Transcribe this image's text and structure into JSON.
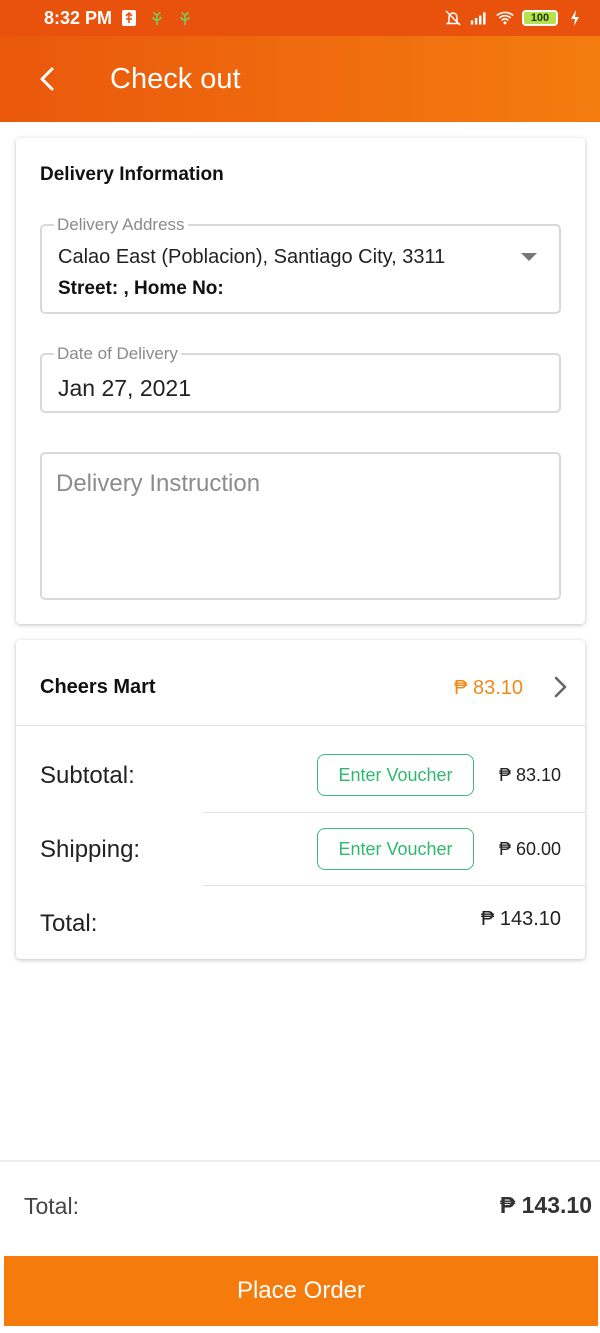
{
  "status_bar": {
    "time": "8:32 PM",
    "battery": "100",
    "left_icons": [
      "usb-icon",
      "plant-icon",
      "plant-icon"
    ],
    "right_icons": [
      "alarm-off-icon",
      "signal-icon",
      "wifi-icon",
      "battery-icon",
      "charging-icon"
    ]
  },
  "app_bar": {
    "title": "Check out",
    "back_icon": "arrow-back-icon",
    "background_color": "#ea580c"
  },
  "delivery": {
    "section_title": "Delivery Information",
    "address_label": "Delivery Address",
    "address_line1": "Calao East (Poblacion), Santiago City, 3311",
    "address_line2": "Street: , Home No:",
    "date_label": "Date of Delivery",
    "date_value": "Jan 27, 2021",
    "instruction_placeholder": "Delivery Instruction"
  },
  "store": {
    "name": "Cheers Mart",
    "total": "₱ 83.10",
    "accent_color": "#ef8a1a",
    "rows": {
      "subtotal_label": "Subtotal:",
      "subtotal_voucher": "Enter Voucher",
      "subtotal_amount": "₱ 83.10",
      "shipping_label": "Shipping:",
      "shipping_voucher": "Enter Voucher",
      "shipping_amount": "₱ 60.00",
      "total_label": "Total:",
      "total_amount": "₱ 143.10"
    },
    "voucher_color": "#2fb96d"
  },
  "footer": {
    "total_label": "Total:",
    "total_amount": "₱ 143.10",
    "place_order_label": "Place Order",
    "button_color": "#f57c0c"
  }
}
